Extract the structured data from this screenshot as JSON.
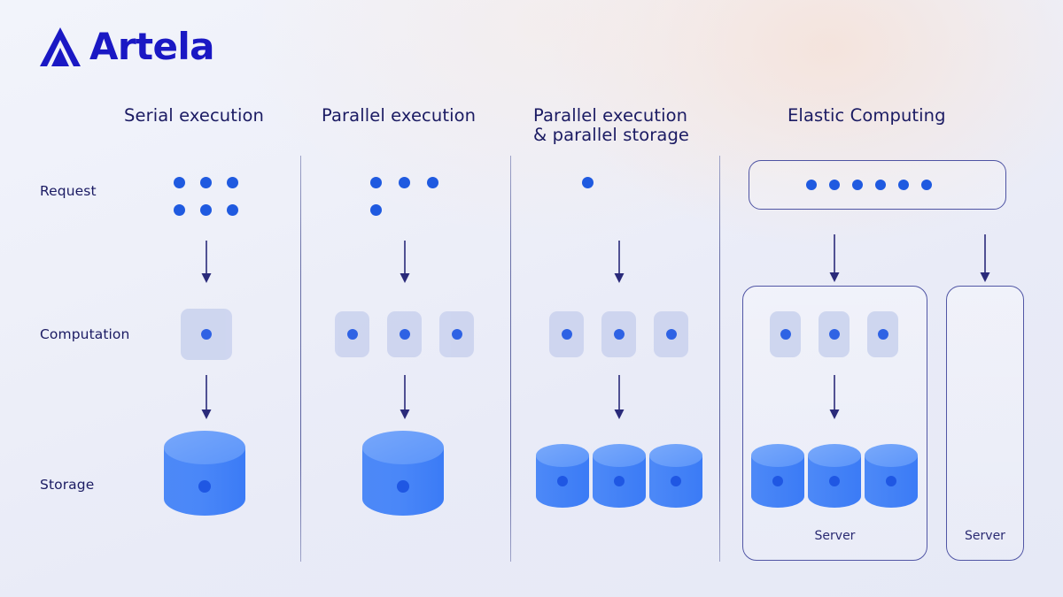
{
  "brand": {
    "name": "Artela",
    "logo_icon": "artela-triangle-logo",
    "color": "#1a18c4"
  },
  "theme": {
    "background_from": "#f2f4fb",
    "background_to": "#e6e9f6",
    "accent_blue": "#1f5ae0",
    "navy": "#1b1b63",
    "cylinder_blue": "#4d8bf8",
    "cell_fill": "#ccd4ef",
    "divider": "#5a61a0"
  },
  "rows": [
    {
      "key": "request",
      "label": "Request"
    },
    {
      "key": "computation",
      "label": "Computation"
    },
    {
      "key": "storage",
      "label": "Storage"
    }
  ],
  "columns": [
    {
      "id": "serial",
      "title": "Serial execution",
      "request_dots": 6,
      "request_layout": "3x2 grid",
      "computation_cells": 1,
      "storage_units": 1,
      "storage_size": "large",
      "arrows": 2
    },
    {
      "id": "parallel-exec",
      "title": "Parallel execution",
      "request_dots": 4,
      "request_layout": "3 top, 1 bottom",
      "computation_cells": 3,
      "storage_units": 1,
      "storage_size": "large",
      "arrows": 2
    },
    {
      "id": "parallel-exec-storage",
      "title": "Parallel execution\n& parallel storage",
      "request_dots": 1,
      "request_layout": "single",
      "computation_cells": 3,
      "storage_units": 3,
      "storage_size": "small",
      "arrows": 2
    },
    {
      "id": "elastic-computing",
      "title": "Elastic Computing",
      "request_dots": 6,
      "request_layout": "row in container",
      "computation_cells": 3,
      "storage_units": 3,
      "storage_size": "small",
      "arrows": 3,
      "servers": [
        {
          "label": "Server",
          "populated": true
        },
        {
          "label": "Server",
          "populated": false
        }
      ]
    }
  ]
}
